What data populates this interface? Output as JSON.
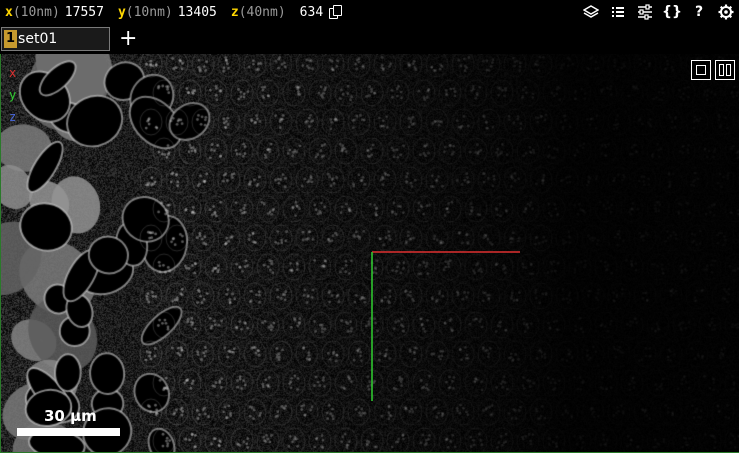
{
  "coords": {
    "x": {
      "label": "x",
      "unit": "(10nm)",
      "value": "17557"
    },
    "y": {
      "label": "y",
      "unit": "(10nm)",
      "value": "13405"
    },
    "z": {
      "label": "z",
      "unit": "(40nm)",
      "value": "634"
    }
  },
  "toolbar": {
    "icons": [
      "layers-icon",
      "list-icon",
      "settings-sliders-icon",
      "json-braces-icon",
      "help-icon",
      "gear-icon"
    ],
    "braces": "{}",
    "help": "?"
  },
  "layer": {
    "number": "1",
    "name": "set01",
    "add": "+"
  },
  "viewer": {
    "axes": {
      "x": "x",
      "y": "y",
      "z": "z"
    },
    "colors": {
      "x": "#e03030",
      "y": "#30d030",
      "z": "#4a6ae0"
    },
    "scalebar": "30 µm"
  }
}
